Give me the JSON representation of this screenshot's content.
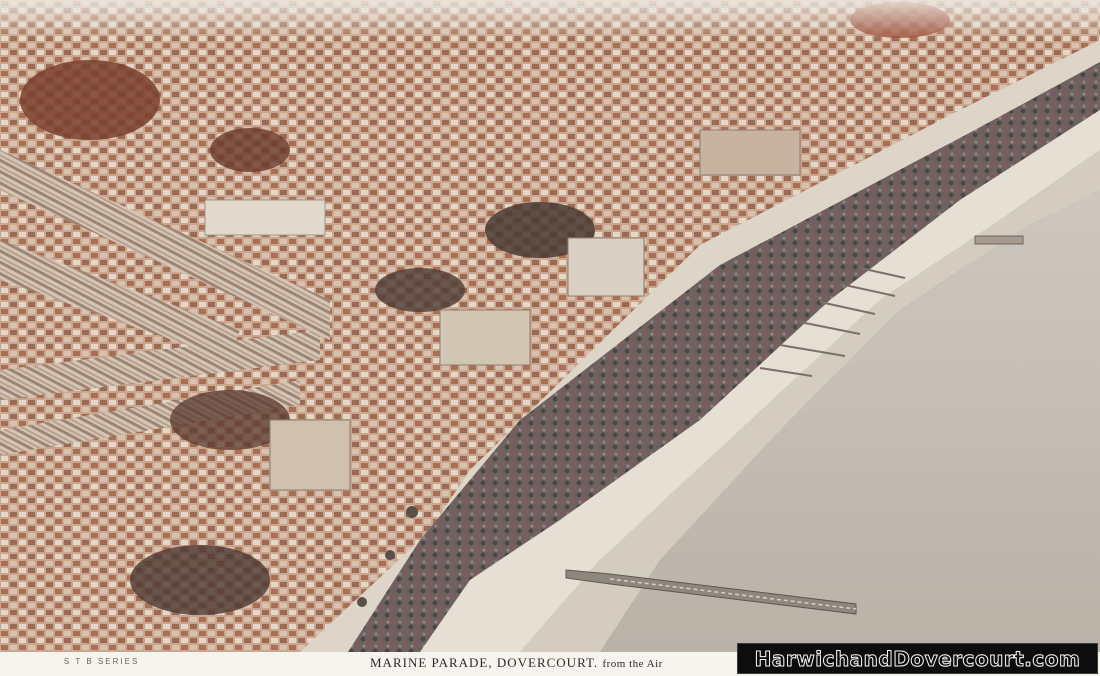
{
  "photo": {
    "subject": "aerial-view",
    "colors": {
      "sea": "#bdb7ad",
      "promenade": "#e4ded2",
      "road": "#d8d1c4",
      "embankment": "#5f5a57",
      "roofs": "#b98a70",
      "brick": "#a0674e",
      "trees": "#6a3a2c"
    }
  },
  "caption": {
    "series": "S T B SERIES",
    "title": "MARINE PARADE, DOVERCOURT.",
    "subtitle": "from the Air"
  },
  "watermark": {
    "text": "HarwichandDovercourt.com"
  }
}
